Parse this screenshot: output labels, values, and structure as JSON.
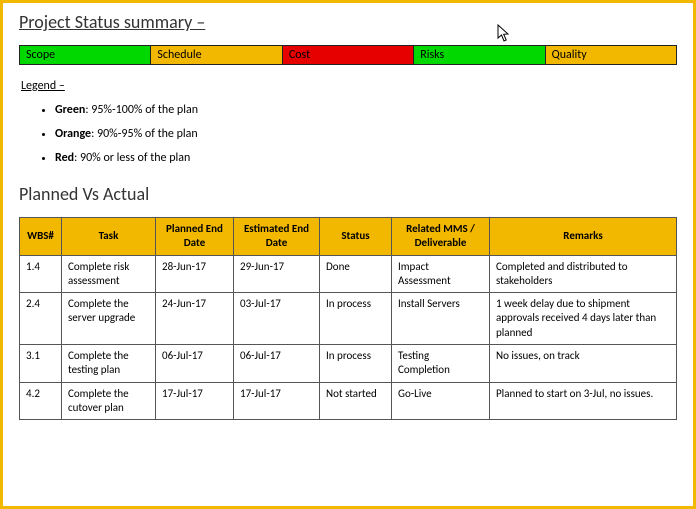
{
  "title": "Project Status summary –",
  "status_bar": [
    {
      "label": "Scope",
      "color": "green"
    },
    {
      "label": "Schedule",
      "color": "orange"
    },
    {
      "label": "Cost",
      "color": "red"
    },
    {
      "label": "Risks",
      "color": "green"
    },
    {
      "label": "Quality",
      "color": "orange"
    }
  ],
  "legend_title": "Legend –",
  "legend": [
    {
      "color": "Green",
      "desc": ": 95%-100% of the plan"
    },
    {
      "color": "Orange",
      "desc": ": 90%-95% of the plan"
    },
    {
      "color": "Red",
      "desc": ": 90% or less of the plan"
    }
  ],
  "section2_title": "Planned Vs Actual",
  "table": {
    "headers": [
      "WBS#",
      "Task",
      "Planned End Date",
      "Estimated End Date",
      "Status",
      "Related MMS / Deliverable",
      "Remarks"
    ],
    "rows": [
      {
        "wbs": "1.4",
        "task": "Complete risk assessment",
        "planned": "28-Jun-17",
        "estimated": "29-Jun-17",
        "status": "Done",
        "mms": "Impact Assessment",
        "remarks": "Completed and distributed to stakeholders"
      },
      {
        "wbs": "2.4",
        "task": "Complete the server upgrade",
        "planned": "24-Jun-17",
        "estimated": "03-Jul-17",
        "status": "In process",
        "mms": "Install Servers",
        "remarks": "1 week delay due to shipment approvals received 4 days later than planned"
      },
      {
        "wbs": "3.1",
        "task": "Complete the testing plan",
        "planned": "06-Jul-17",
        "estimated": "06-Jul-17",
        "status": "In process",
        "mms": "Testing Completion",
        "remarks": "No issues, on track"
      },
      {
        "wbs": "4.2",
        "task": "Complete the cutover plan",
        "planned": "17-Jul-17",
        "estimated": "17-Jul-17",
        "status": "Not started",
        "mms": "Go-Live",
        "remarks": "Planned to start on 3-Jul, no issues."
      }
    ]
  }
}
